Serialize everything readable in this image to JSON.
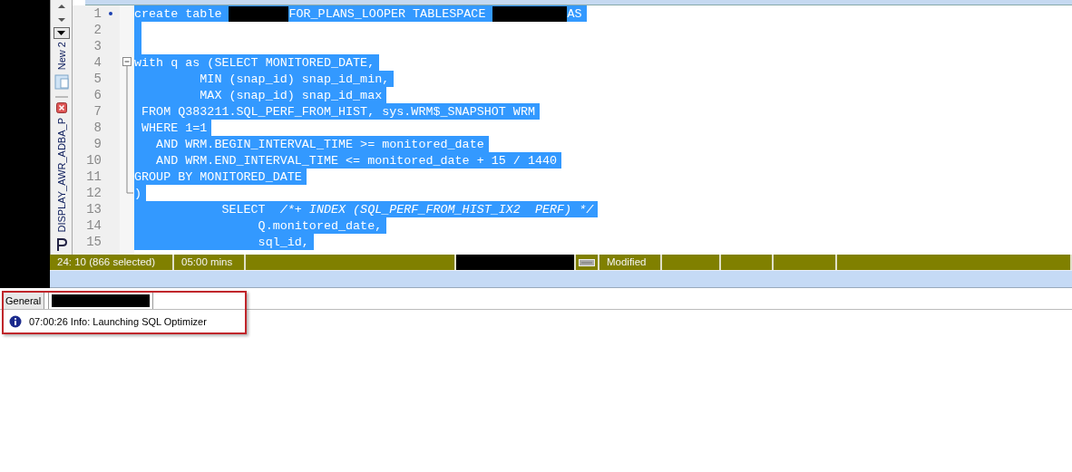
{
  "sidebar": {
    "tabs": [
      {
        "label": "New 2",
        "kind": "sql"
      },
      {
        "label": "DISPLAY_AWR_ADBA_P",
        "kind": "procedure"
      }
    ]
  },
  "editor": {
    "lines": [
      {
        "num": "1",
        "selected": true,
        "bookmark": true,
        "segments": [
          {
            "kind": "text",
            "text": "create table "
          },
          {
            "kind": "redacted"
          },
          {
            "kind": "text",
            "text": "FOR_PLANS_LOOPER TABLESPACE "
          },
          {
            "kind": "redacted"
          },
          {
            "kind": "text",
            "text": "AS"
          }
        ]
      },
      {
        "num": "2",
        "selected": true,
        "bookmark": false
      },
      {
        "num": "3",
        "selected": true,
        "bookmark": false
      },
      {
        "num": "4",
        "selected": true,
        "bookmark": false,
        "kind": "fold_start",
        "segments": [
          {
            "kind": "text",
            "text": "with q as (SELECT MONITORED_DATE,"
          }
        ]
      },
      {
        "num": "5",
        "selected": true,
        "bookmark": false,
        "kind": "fold_body",
        "segments": [
          {
            "kind": "text",
            "text": "         MIN (snap_id) snap_id_min,"
          }
        ]
      },
      {
        "num": "6",
        "selected": true,
        "bookmark": false,
        "kind": "fold_body",
        "segments": [
          {
            "kind": "text",
            "text": "         MAX (snap_id) snap_id_max"
          }
        ]
      },
      {
        "num": "7",
        "selected": true,
        "bookmark": false,
        "kind": "fold_body",
        "segments": [
          {
            "kind": "text",
            "text": " FROM Q383211.SQL_PERF_FROM_HIST, sys.WRM$_SNAPSHOT WRM"
          }
        ]
      },
      {
        "num": "8",
        "selected": true,
        "bookmark": false,
        "kind": "fold_body",
        "segments": [
          {
            "kind": "text",
            "text": " WHERE 1=1"
          }
        ]
      },
      {
        "num": "9",
        "selected": true,
        "bookmark": false,
        "kind": "fold_body",
        "segments": [
          {
            "kind": "text",
            "text": "   AND WRM.BEGIN_INTERVAL_TIME >= monitored_date"
          }
        ]
      },
      {
        "num": "10",
        "selected": true,
        "bookmark": false,
        "kind": "fold_body",
        "segments": [
          {
            "kind": "text",
            "text": "   AND WRM.END_INTERVAL_TIME <= monitored_date + 15 / 1440"
          }
        ]
      },
      {
        "num": "11",
        "selected": true,
        "bookmark": false,
        "kind": "fold_body",
        "segments": [
          {
            "kind": "text",
            "text": "GROUP BY MONITORED_DATE"
          }
        ]
      },
      {
        "num": "12",
        "selected": true,
        "bookmark": false,
        "kind": "fold_end",
        "segments": [
          {
            "kind": "text",
            "text": ")"
          }
        ]
      },
      {
        "num": "13",
        "selected": true,
        "bookmark": false,
        "segments": [
          {
            "kind": "text",
            "text": "            SELECT  "
          },
          {
            "kind": "comment",
            "text": "/*+ INDEX (SQL_PERF_FROM_HIST_IX2  PERF) */"
          }
        ]
      },
      {
        "num": "14",
        "selected": true,
        "bookmark": false,
        "segments": [
          {
            "kind": "text",
            "text": "                 Q.monitored_date,"
          }
        ]
      },
      {
        "num": "15",
        "selected": true,
        "bookmark": false,
        "segments": [
          {
            "kind": "text",
            "text": "                 sql_id,"
          }
        ]
      }
    ]
  },
  "status_bar": [
    {
      "kind": "text",
      "text": "24:  10  (866 selected)"
    },
    {
      "kind": "text",
      "text": "05:00 mins"
    },
    {
      "kind": "blank"
    },
    {
      "kind": "redacted"
    },
    {
      "kind": "icon"
    },
    {
      "kind": "text",
      "text": "Modified"
    },
    {
      "kind": "blank"
    },
    {
      "kind": "blank"
    },
    {
      "kind": "blank"
    },
    {
      "kind": "blank"
    }
  ],
  "output": {
    "tabs": [
      {
        "kind": "text",
        "label": "General",
        "selected": false
      },
      {
        "kind": "redacted",
        "selected": true
      }
    ],
    "messages": [
      {
        "kind": "info",
        "text": "07:00:26 Info: Launching SQL Optimizer"
      }
    ],
    "callout": true
  }
}
